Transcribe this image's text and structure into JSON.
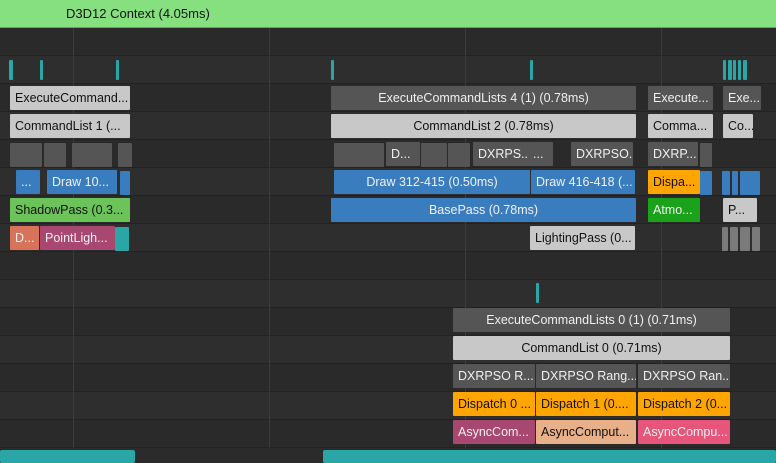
{
  "context": {
    "label": "D3D12 Context (4.05ms)"
  },
  "colors": {
    "gray_dark": "#555555",
    "gray_light": "#c8c8c8",
    "blue": "#3a7dbf",
    "green": "#6cc35a",
    "green_dark": "#1aa31a",
    "orange": "#ffa500",
    "salmon": "#d6735a",
    "plum": "#a84870",
    "teal": "#2aa6a6",
    "peach": "#e8b088",
    "pink": "#e8557a"
  },
  "rows": [
    {
      "items": [
        {
          "text": "ExecuteCommand...",
          "color": "gray_light",
          "align": "left"
        },
        {
          "text": "ExecuteCommandLists 4 (1) (0.78ms)",
          "color": "gray_dark",
          "align": "center"
        },
        {
          "text": "Execute...",
          "color": "gray_dark",
          "align": "left"
        },
        {
          "text": "Exe...",
          "color": "gray_dark",
          "align": "left"
        }
      ]
    },
    {
      "items": [
        {
          "text": "CommandList 1 (...",
          "color": "gray_light",
          "align": "left"
        },
        {
          "text": "CommandList 2 (0.78ms)",
          "color": "gray_light",
          "align": "center"
        },
        {
          "text": "Comma...",
          "color": "gray_light",
          "align": "left"
        },
        {
          "text": "Co...",
          "color": "gray_light",
          "align": "left"
        }
      ]
    },
    {
      "items": [
        {
          "text": "D...",
          "color": "gray_dark",
          "align": "left"
        },
        {
          "text": "DXRPS...",
          "color": "gray_dark",
          "align": "left"
        },
        {
          "text": "...",
          "color": "gray_dark",
          "align": "left"
        },
        {
          "text": "DXRPSO...",
          "color": "gray_dark",
          "align": "left"
        },
        {
          "text": "DXRP...",
          "color": "gray_dark",
          "align": "left"
        }
      ]
    },
    {
      "items": [
        {
          "text": "...",
          "color": "blue",
          "align": "left"
        },
        {
          "text": "Draw 10...",
          "color": "blue",
          "align": "left"
        },
        {
          "text": "Draw 312-415 (0.50ms)",
          "color": "blue",
          "align": "center"
        },
        {
          "text": "Draw 416-418 (...",
          "color": "blue",
          "align": "left"
        },
        {
          "text": "Dispa...",
          "color": "orange",
          "align": "left"
        }
      ]
    },
    {
      "items": [
        {
          "text": "ShadowPass (0.3...",
          "color": "green",
          "align": "left"
        },
        {
          "text": "BasePass (0.78ms)",
          "color": "blue",
          "align": "center"
        },
        {
          "text": "Atmo...",
          "color": "green_dark",
          "align": "left"
        },
        {
          "text": "P...",
          "color": "gray_light",
          "align": "left"
        }
      ]
    },
    {
      "items": [
        {
          "text": "D...",
          "color": "salmon",
          "align": "left"
        },
        {
          "text": "PointLigh...",
          "color": "plum",
          "align": "left"
        },
        {
          "text": "LightingPass (0...",
          "color": "gray_light",
          "align": "left"
        }
      ]
    },
    {
      "items": [
        {
          "text": "ExecuteCommandLists 0 (1) (0.71ms)",
          "color": "gray_dark",
          "align": "center"
        }
      ]
    },
    {
      "items": [
        {
          "text": "CommandList 0 (0.71ms)",
          "color": "gray_light",
          "align": "center"
        }
      ]
    },
    {
      "items": [
        {
          "text": "DXRPSO R...",
          "color": "gray_dark",
          "align": "left"
        },
        {
          "text": "DXRPSO Rang...",
          "color": "gray_dark",
          "align": "left"
        },
        {
          "text": "DXRPSO Ran...",
          "color": "gray_dark",
          "align": "left"
        }
      ]
    },
    {
      "items": [
        {
          "text": "Dispatch 0 ...",
          "color": "orange",
          "align": "left"
        },
        {
          "text": "Dispatch 1 (0....",
          "color": "orange",
          "align": "left"
        },
        {
          "text": "Dispatch 2 (0...",
          "color": "orange",
          "align": "left"
        }
      ]
    },
    {
      "items": [
        {
          "text": "AsyncCom...",
          "color": "plum",
          "align": "left"
        },
        {
          "text": "AsyncComput...",
          "color": "peach",
          "align": "left"
        },
        {
          "text": "AsyncCompu...",
          "color": "pink",
          "align": "left"
        }
      ]
    }
  ]
}
